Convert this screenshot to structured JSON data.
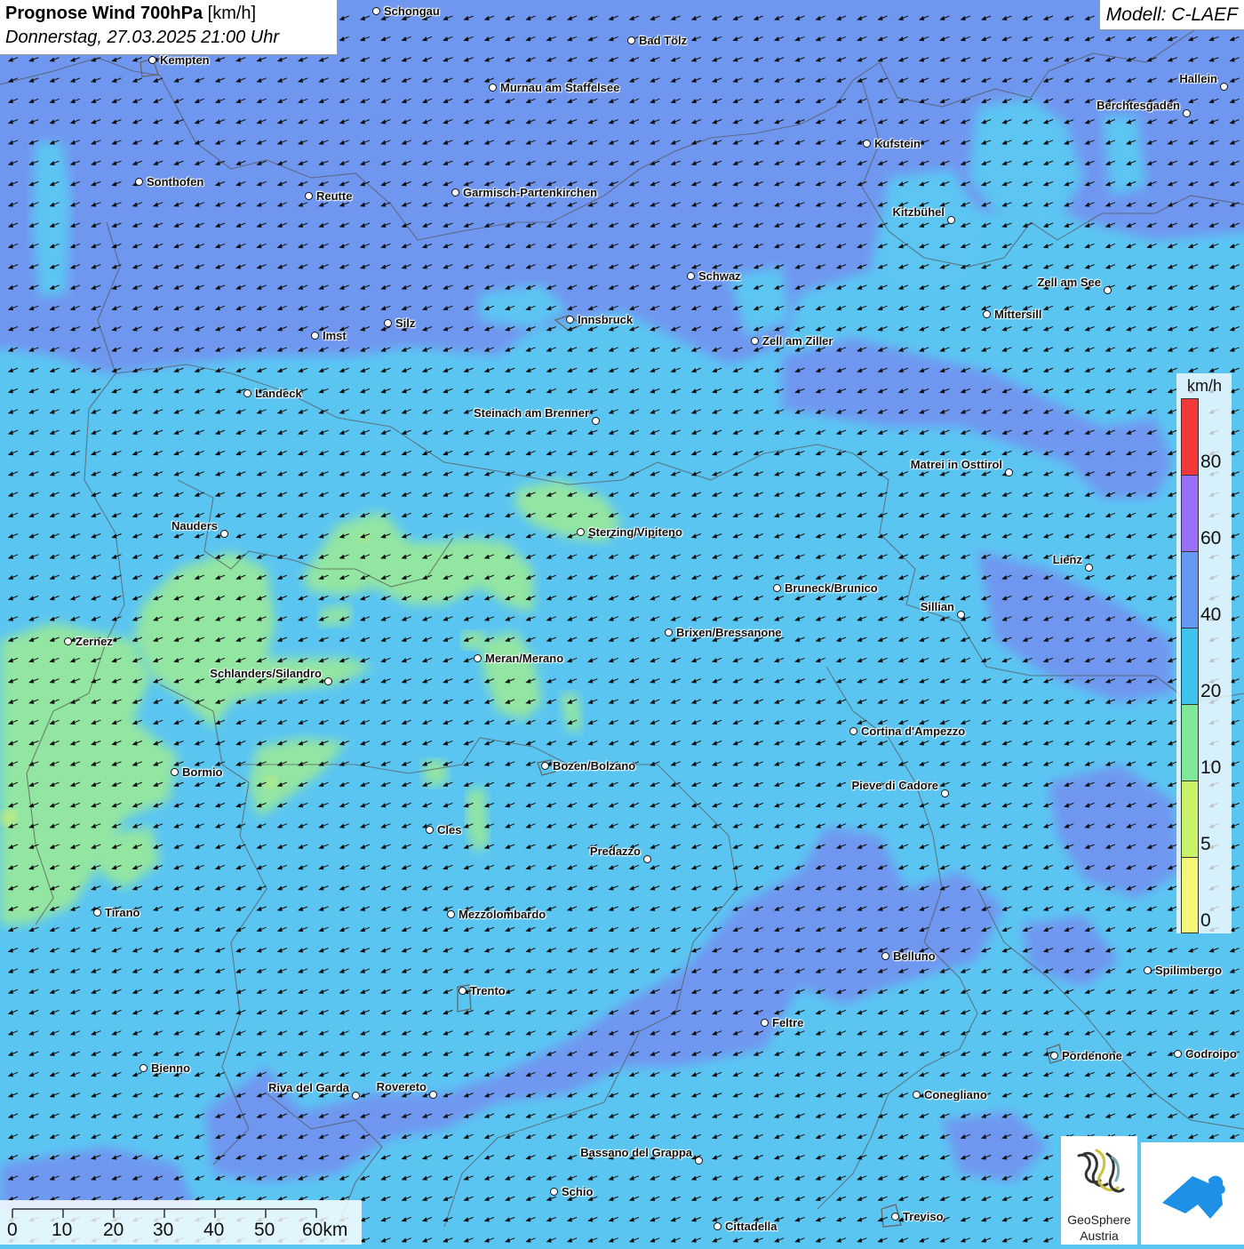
{
  "title": {
    "bold": "Prognose Wind 700hPa",
    "unit": "[km/h]",
    "datetime": "Donnerstag, 27.03.2025 21:00 Uhr"
  },
  "model": "Modell: C-LAEF",
  "legend": {
    "unit": "km/h",
    "labels": [
      "80",
      "60",
      "40",
      "20",
      "10",
      "5",
      "0"
    ],
    "colors": [
      "#f23a3a",
      "#9b6ff5",
      "#6697f2",
      "#3ec3ef",
      "#7ee79a",
      "#c9f26a",
      "#f5f57a"
    ]
  },
  "scale": {
    "labels": [
      "0",
      "10",
      "20",
      "30",
      "40",
      "50",
      "60km"
    ]
  },
  "branding": {
    "org_line1": "GeoSphere",
    "org_line2": "Austria"
  },
  "wind_direction": "from north-east",
  "cities": [
    {
      "name": "Schongau"
    },
    {
      "name": "Kempten"
    },
    {
      "name": "Bad Tölz"
    },
    {
      "name": "Murnau am Staffelsee"
    },
    {
      "name": "Hallein"
    },
    {
      "name": "Berchtesgaden"
    },
    {
      "name": "Kufstein"
    },
    {
      "name": "Sonthofen"
    },
    {
      "name": "Reutte"
    },
    {
      "name": "Garmisch-Partenkirchen"
    },
    {
      "name": "Kitzbühel"
    },
    {
      "name": "Schwaz"
    },
    {
      "name": "Zell am See"
    },
    {
      "name": "Mittersill"
    },
    {
      "name": "Innsbruck"
    },
    {
      "name": "Imst"
    },
    {
      "name": "Silz"
    },
    {
      "name": "Zell am Ziller"
    },
    {
      "name": "Landeck"
    },
    {
      "name": "Steinach am Brenner"
    },
    {
      "name": "Matrei in Osttirol"
    },
    {
      "name": "Nauders"
    },
    {
      "name": "Sterzing/Vipiteno"
    },
    {
      "name": "Lienz"
    },
    {
      "name": "Bruneck/Brunico"
    },
    {
      "name": "Sillian"
    },
    {
      "name": "Brixen/Bressanone"
    },
    {
      "name": "Zernez"
    },
    {
      "name": "Meran/Merano"
    },
    {
      "name": "Schlanders/Silandro"
    },
    {
      "name": "Cortina d'Ampezzo"
    },
    {
      "name": "Bozen/Bolzano"
    },
    {
      "name": "Bormio"
    },
    {
      "name": "Pieve di Cadore"
    },
    {
      "name": "Cles"
    },
    {
      "name": "Predazzo"
    },
    {
      "name": "Tirano"
    },
    {
      "name": "Mezzolombardo"
    },
    {
      "name": "Belluno"
    },
    {
      "name": "Spilimbergo"
    },
    {
      "name": "Trento"
    },
    {
      "name": "Feltre"
    },
    {
      "name": "Pordenone"
    },
    {
      "name": "Codroipo"
    },
    {
      "name": "Bienno"
    },
    {
      "name": "Riva del Garda"
    },
    {
      "name": "Rovereto"
    },
    {
      "name": "Conegliano"
    },
    {
      "name": "Bassano del Grappa"
    },
    {
      "name": "Schio"
    },
    {
      "name": "Treviso"
    },
    {
      "name": "Cittadella"
    }
  ]
}
